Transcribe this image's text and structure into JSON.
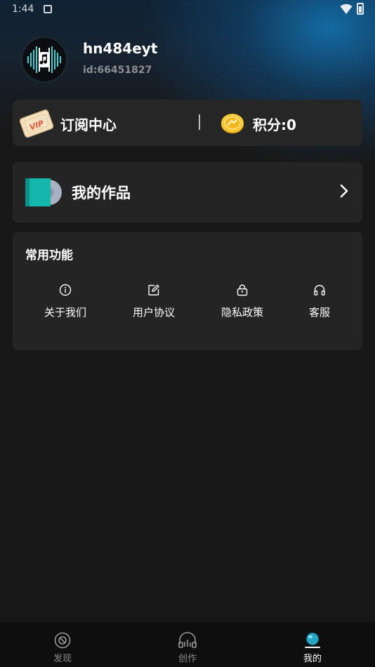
{
  "status_bar": {
    "time": "1:44"
  },
  "profile": {
    "username": "hn484eyt",
    "user_id": "id:66451827"
  },
  "subscription": {
    "label": "订阅中心",
    "badge": "VIP"
  },
  "points": {
    "label": "积分:0"
  },
  "works": {
    "label": "我的作品"
  },
  "functions": {
    "title": "常用功能",
    "items": [
      {
        "label": "关于我们",
        "icon": "info-icon"
      },
      {
        "label": "用户协议",
        "icon": "edit-icon"
      },
      {
        "label": "隐私政策",
        "icon": "lock-icon"
      },
      {
        "label": "客服",
        "icon": "headphones-icon"
      }
    ]
  },
  "nav": {
    "items": [
      {
        "label": "发现",
        "icon": "disc-icon",
        "active": false
      },
      {
        "label": "创作",
        "icon": "mixer-icon",
        "active": false
      },
      {
        "label": "我的",
        "icon": "profile-icon",
        "active": true
      }
    ]
  },
  "colors": {
    "background": "#181818",
    "card": "#242424",
    "accent": "#17b6b0",
    "coin": "#f2b820",
    "nav": "#0e0e0e"
  }
}
